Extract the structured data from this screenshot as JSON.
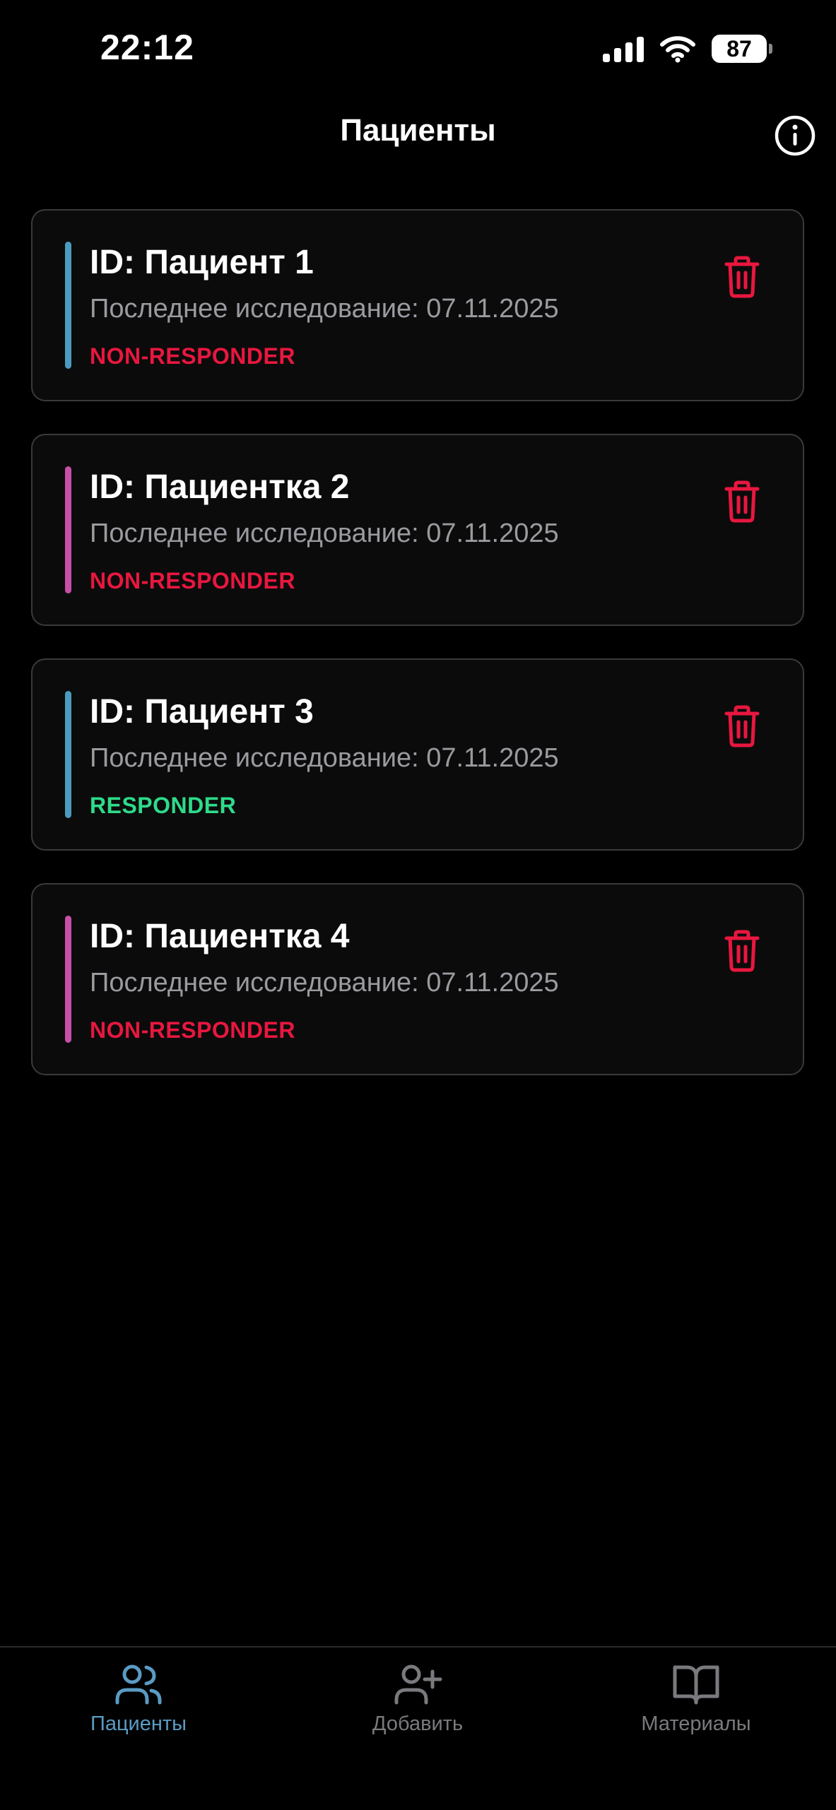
{
  "status_bar": {
    "time": "22:12",
    "battery_level": "87"
  },
  "header": {
    "title": "Пациенты"
  },
  "patients": [
    {
      "name": "ID: Пациент 1",
      "last_exam": "Последнее исследование: 07.11.2025",
      "status": "NON-RESPONDER",
      "accent_color": "#4a9bbf",
      "status_color": "#e8173f"
    },
    {
      "name": "ID: Пациентка 2",
      "last_exam": "Последнее исследование: 07.11.2025",
      "status": "NON-RESPONDER",
      "accent_color": "#c84fa8",
      "status_color": "#e8173f"
    },
    {
      "name": "ID: Пациент 3",
      "last_exam": "Последнее исследование: 07.11.2025",
      "status": "RESPONDER",
      "accent_color": "#4a9bbf",
      "status_color": "#2edb8a"
    },
    {
      "name": "ID: Пациентка 4",
      "last_exam": "Последнее исследование: 07.11.2025",
      "status": "NON-RESPONDER",
      "accent_color": "#c84fa8",
      "status_color": "#e8173f"
    }
  ],
  "tab_bar": {
    "tabs": [
      {
        "label": "Пациенты",
        "icon": "users-icon",
        "active": true
      },
      {
        "label": "Добавить",
        "icon": "user-plus-icon",
        "active": false
      },
      {
        "label": "Материалы",
        "icon": "book-open-icon",
        "active": false
      }
    ]
  },
  "colors": {
    "background": "#000000",
    "card_background": "#0b0b0b",
    "card_border": "#3a3a3c",
    "delete_icon": "#e8173f",
    "tab_active": "#5a9bc4",
    "tab_inactive": "#7a7a7e",
    "secondary_text": "#9a9aa0"
  }
}
